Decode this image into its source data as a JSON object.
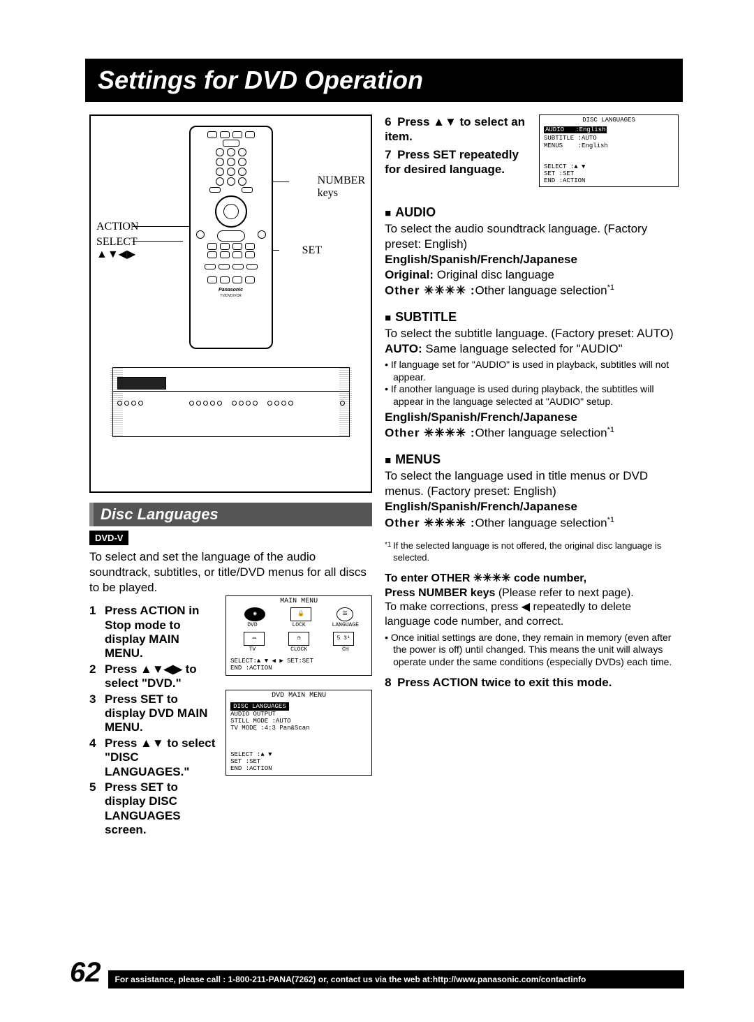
{
  "title": "Settings for DVD Operation",
  "remote_labels": {
    "action": "ACTION",
    "select": "SELECT",
    "arrows": "▲▼◀▶",
    "number": "NUMBER",
    "keys": "keys",
    "set": "SET",
    "brand": "Panasonic",
    "model": "TV/DVD/VCR"
  },
  "section_header": "Disc Languages",
  "dvdv_badge": "DVD-V",
  "intro": "To select and set the language of the audio soundtrack, subtitles, or title/DVD menus for all discs to be played.",
  "steps_left": [
    "Press ACTION in Stop mode to display MAIN MENU.",
    "Press ▲▼◀▶ to select \"DVD.\"",
    "Press SET to display DVD MAIN MENU.",
    "Press ▲▼ to select \"DISC LANGUAGES.\"",
    "Press SET to display DISC LANGUAGES screen."
  ],
  "osd_main": {
    "title": "MAIN MENU",
    "row1": {
      "a": "DVD",
      "b": "LOCK",
      "c": "LANGUAGE"
    },
    "row2": {
      "a": "TV",
      "b": "CLOCK",
      "c": "CH",
      "chval": "5 3¹"
    },
    "foot1": "SELECT:▲ ▼ ◀ ▶   SET:SET",
    "foot2": "END   :ACTION"
  },
  "osd_dvdmain": {
    "title": "DVD MAIN MENU",
    "hi": "DISC LANGUAGES",
    "lines": [
      "AUDIO OUTPUT",
      "STILL MODE    :AUTO",
      "TV MODE       :4:3 Pan&Scan"
    ],
    "foot": [
      "SELECT   :▲ ▼",
      "SET      :SET",
      "END      :ACTION"
    ]
  },
  "steps_right": [
    {
      "n": "6",
      "t": "Press ▲▼ to select an item."
    },
    {
      "n": "7",
      "t": "Press SET repeatedly for desired language."
    }
  ],
  "osd_disc": {
    "title": "DISC LANGUAGES",
    "audio": {
      "k": "AUDIO",
      "v": ":English"
    },
    "sub": {
      "k": "SUBTITLE",
      "v": ":AUTO"
    },
    "menus": {
      "k": "MENUS",
      "v": ":English"
    },
    "foot": [
      "SELECT   :▲ ▼",
      "SET      :SET",
      "END      :ACTION"
    ]
  },
  "audio": {
    "head": "AUDIO",
    "p1": "To select the audio soundtrack language. (Factory preset: English)",
    "opts": "English/Spanish/French/Japanese",
    "orig_l": "Original:",
    "orig_v": " Original disc language",
    "other_l": "Other ✳✳✳✳ :",
    "other_v": "Other language selection",
    "sup": "*1"
  },
  "subtitle": {
    "head": "SUBTITLE",
    "p1": "To select the subtitle language. (Factory preset: AUTO)",
    "auto_l": "AUTO:",
    "auto_v": " Same language selected for \"AUDIO\"",
    "bul": [
      "If language set for \"AUDIO\" is used in playback, subtitles will not appear.",
      "If another language is used during playback, the subtitles will appear in the language selected at \"AUDIO\" setup."
    ],
    "opts": "English/Spanish/French/Japanese",
    "other_l": "Other ✳✳✳✳ :",
    "other_v": "Other language selection",
    "sup": "*1"
  },
  "menus": {
    "head": "MENUS",
    "p1": "To select the language used in title menus or DVD menus. (Factory preset: English)",
    "opts": "English/Spanish/French/Japanese",
    "other_l": "Other ✳✳✳✳ :",
    "other_v": "Other language selection",
    "sup": "*1"
  },
  "footnote": {
    "mark": "*1",
    "text": "If the selected language is not offered, the original disc language is selected."
  },
  "othercode": {
    "l1a": "To enter OTHER ✳✳✳✳ code number,",
    "l1b": "Press NUMBER keys",
    "l1c": " (Please refer to next page).",
    "l2": "To make corrections, press ◀ repeatedly to delete language code number, and correct.",
    "bul": "Once initial settings are done, they remain in memory (even after the power is off) until changed. This means the unit will always operate under the same conditions (especially DVDs) each time."
  },
  "step8": {
    "n": "8",
    "t": "Press ACTION twice to exit this mode."
  },
  "page_number": "62",
  "footer": "For assistance, please call : 1-800-211-PANA(7262) or, contact us via the web at:http://www.panasonic.com/contactinfo"
}
